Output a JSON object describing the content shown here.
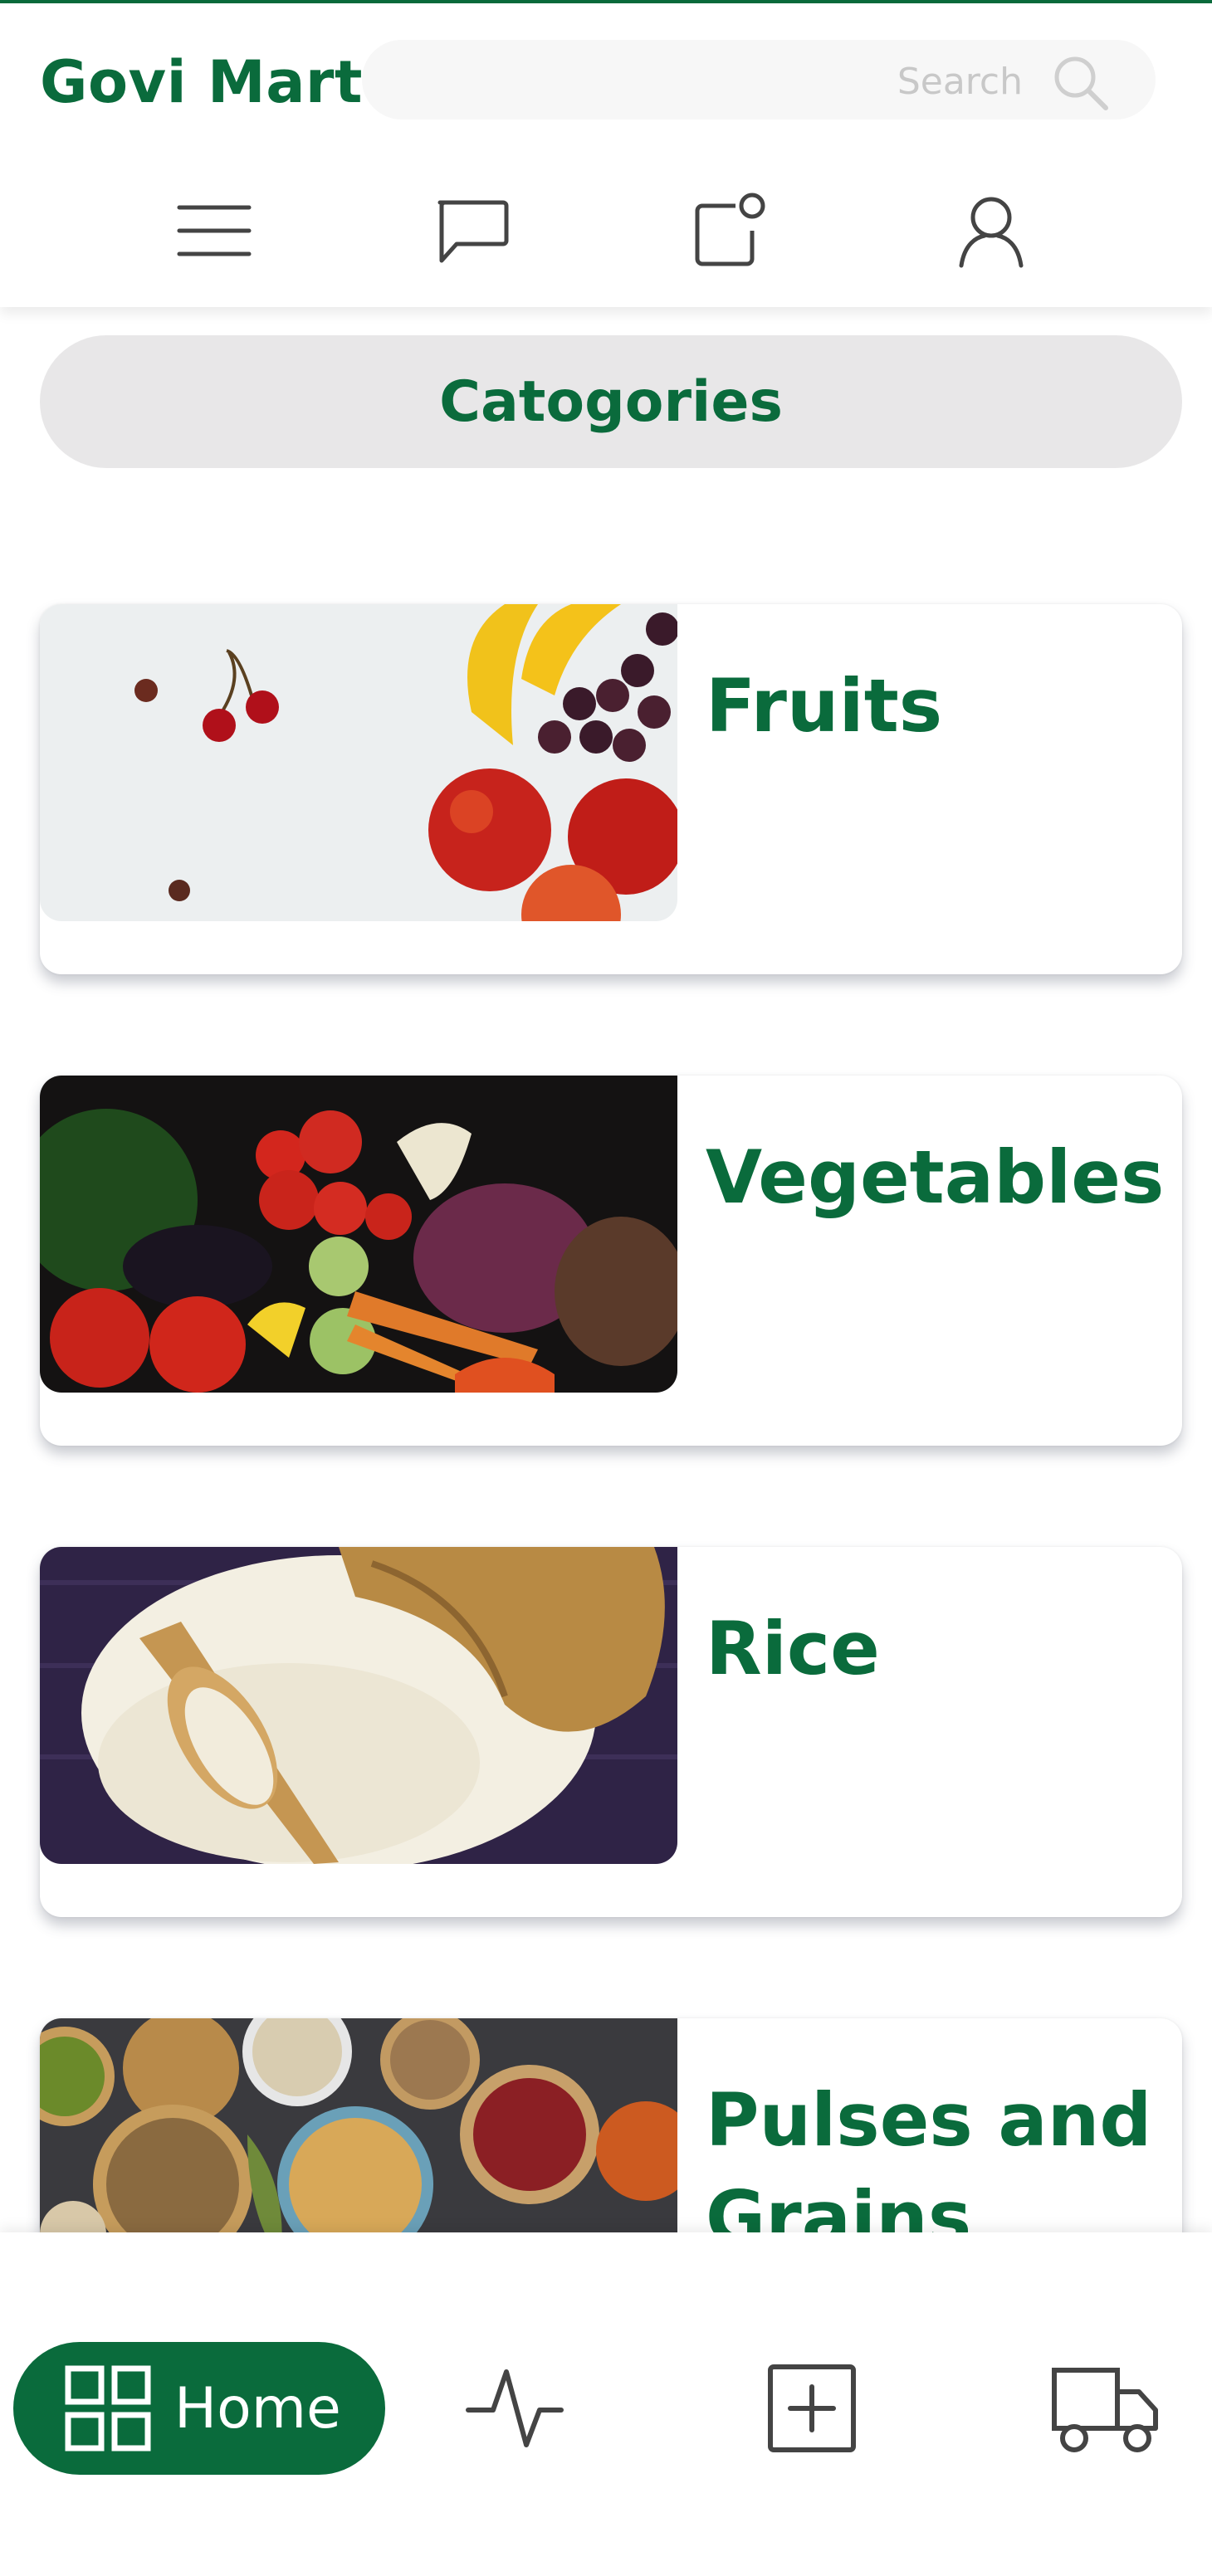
{
  "header": {
    "brand": "Govi Mart",
    "search_placeholder": "Search"
  },
  "categories_title": "Catogories",
  "categories": [
    {
      "label": "Fruits"
    },
    {
      "label": "Vegetables"
    },
    {
      "label": "Rice"
    },
    {
      "label": "Pulses and Grains"
    }
  ],
  "bottom_nav": {
    "home_label": "Home"
  },
  "colors": {
    "brand_green": "#0a6b3c",
    "pill_gray": "#e8e7e8",
    "icon_gray": "#444444"
  },
  "icons": {
    "top_nav": [
      "menu-icon",
      "chat-icon",
      "notification-icon",
      "user-icon"
    ],
    "bottom_nav": [
      "grid-icon",
      "activity-icon",
      "add-square-icon",
      "truck-icon"
    ]
  }
}
